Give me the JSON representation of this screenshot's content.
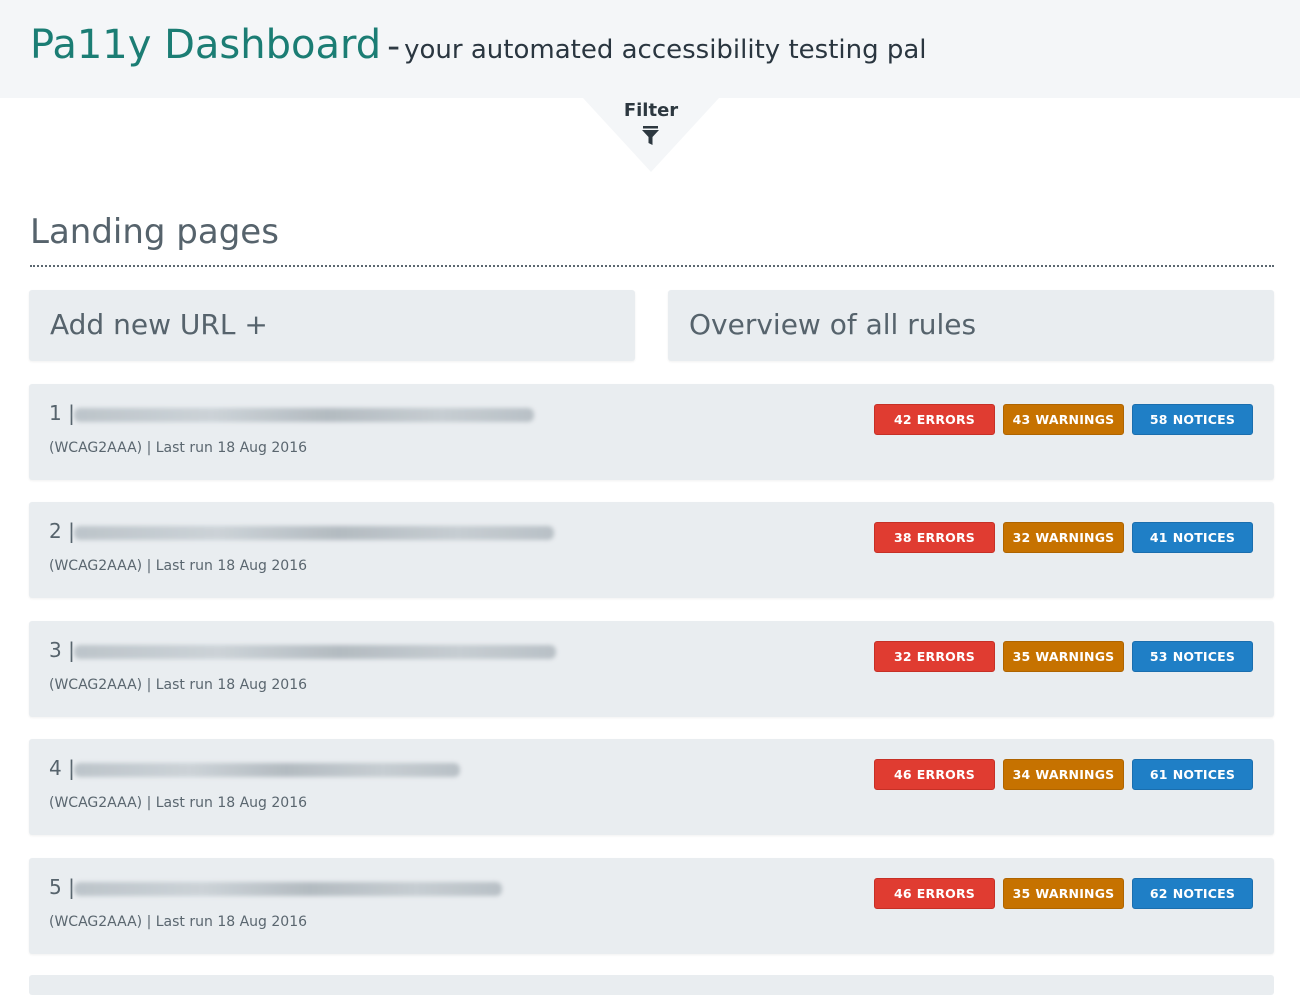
{
  "header": {
    "brand": "Pa11y Dashboard",
    "separator": "-",
    "tagline": "your automated accessibility testing pal"
  },
  "filter": {
    "label": "Filter",
    "icon": "filter-icon"
  },
  "section": {
    "title": "Landing pages"
  },
  "actions": {
    "add_url": "Add new URL +",
    "overview": "Overview of all rules"
  },
  "colors": {
    "brand": "#1b7d74",
    "errors": "#e03c31",
    "warnings": "#c67200",
    "notices": "#1f7fc6"
  },
  "badge_labels": {
    "errors": "ERRORS",
    "warnings": "WARNINGS",
    "notices": "NOTICES"
  },
  "urls": [
    {
      "index": "1 |",
      "meta": "(WCAG2AAA) | Last run 18 Aug 2016",
      "errors": "42",
      "warnings": "43",
      "notices": "58"
    },
    {
      "index": "2 |",
      "meta": "(WCAG2AAA) | Last run 18 Aug 2016",
      "errors": "38",
      "warnings": "32",
      "notices": "41"
    },
    {
      "index": "3 |",
      "meta": "(WCAG2AAA) | Last run 18 Aug 2016",
      "errors": "32",
      "warnings": "35",
      "notices": "53"
    },
    {
      "index": "4 |",
      "meta": "(WCAG2AAA) | Last run 18 Aug 2016",
      "errors": "46",
      "warnings": "34",
      "notices": "61"
    },
    {
      "index": "5 |",
      "meta": "(WCAG2AAA) | Last run 18 Aug 2016",
      "errors": "46",
      "warnings": "35",
      "notices": "62"
    }
  ]
}
